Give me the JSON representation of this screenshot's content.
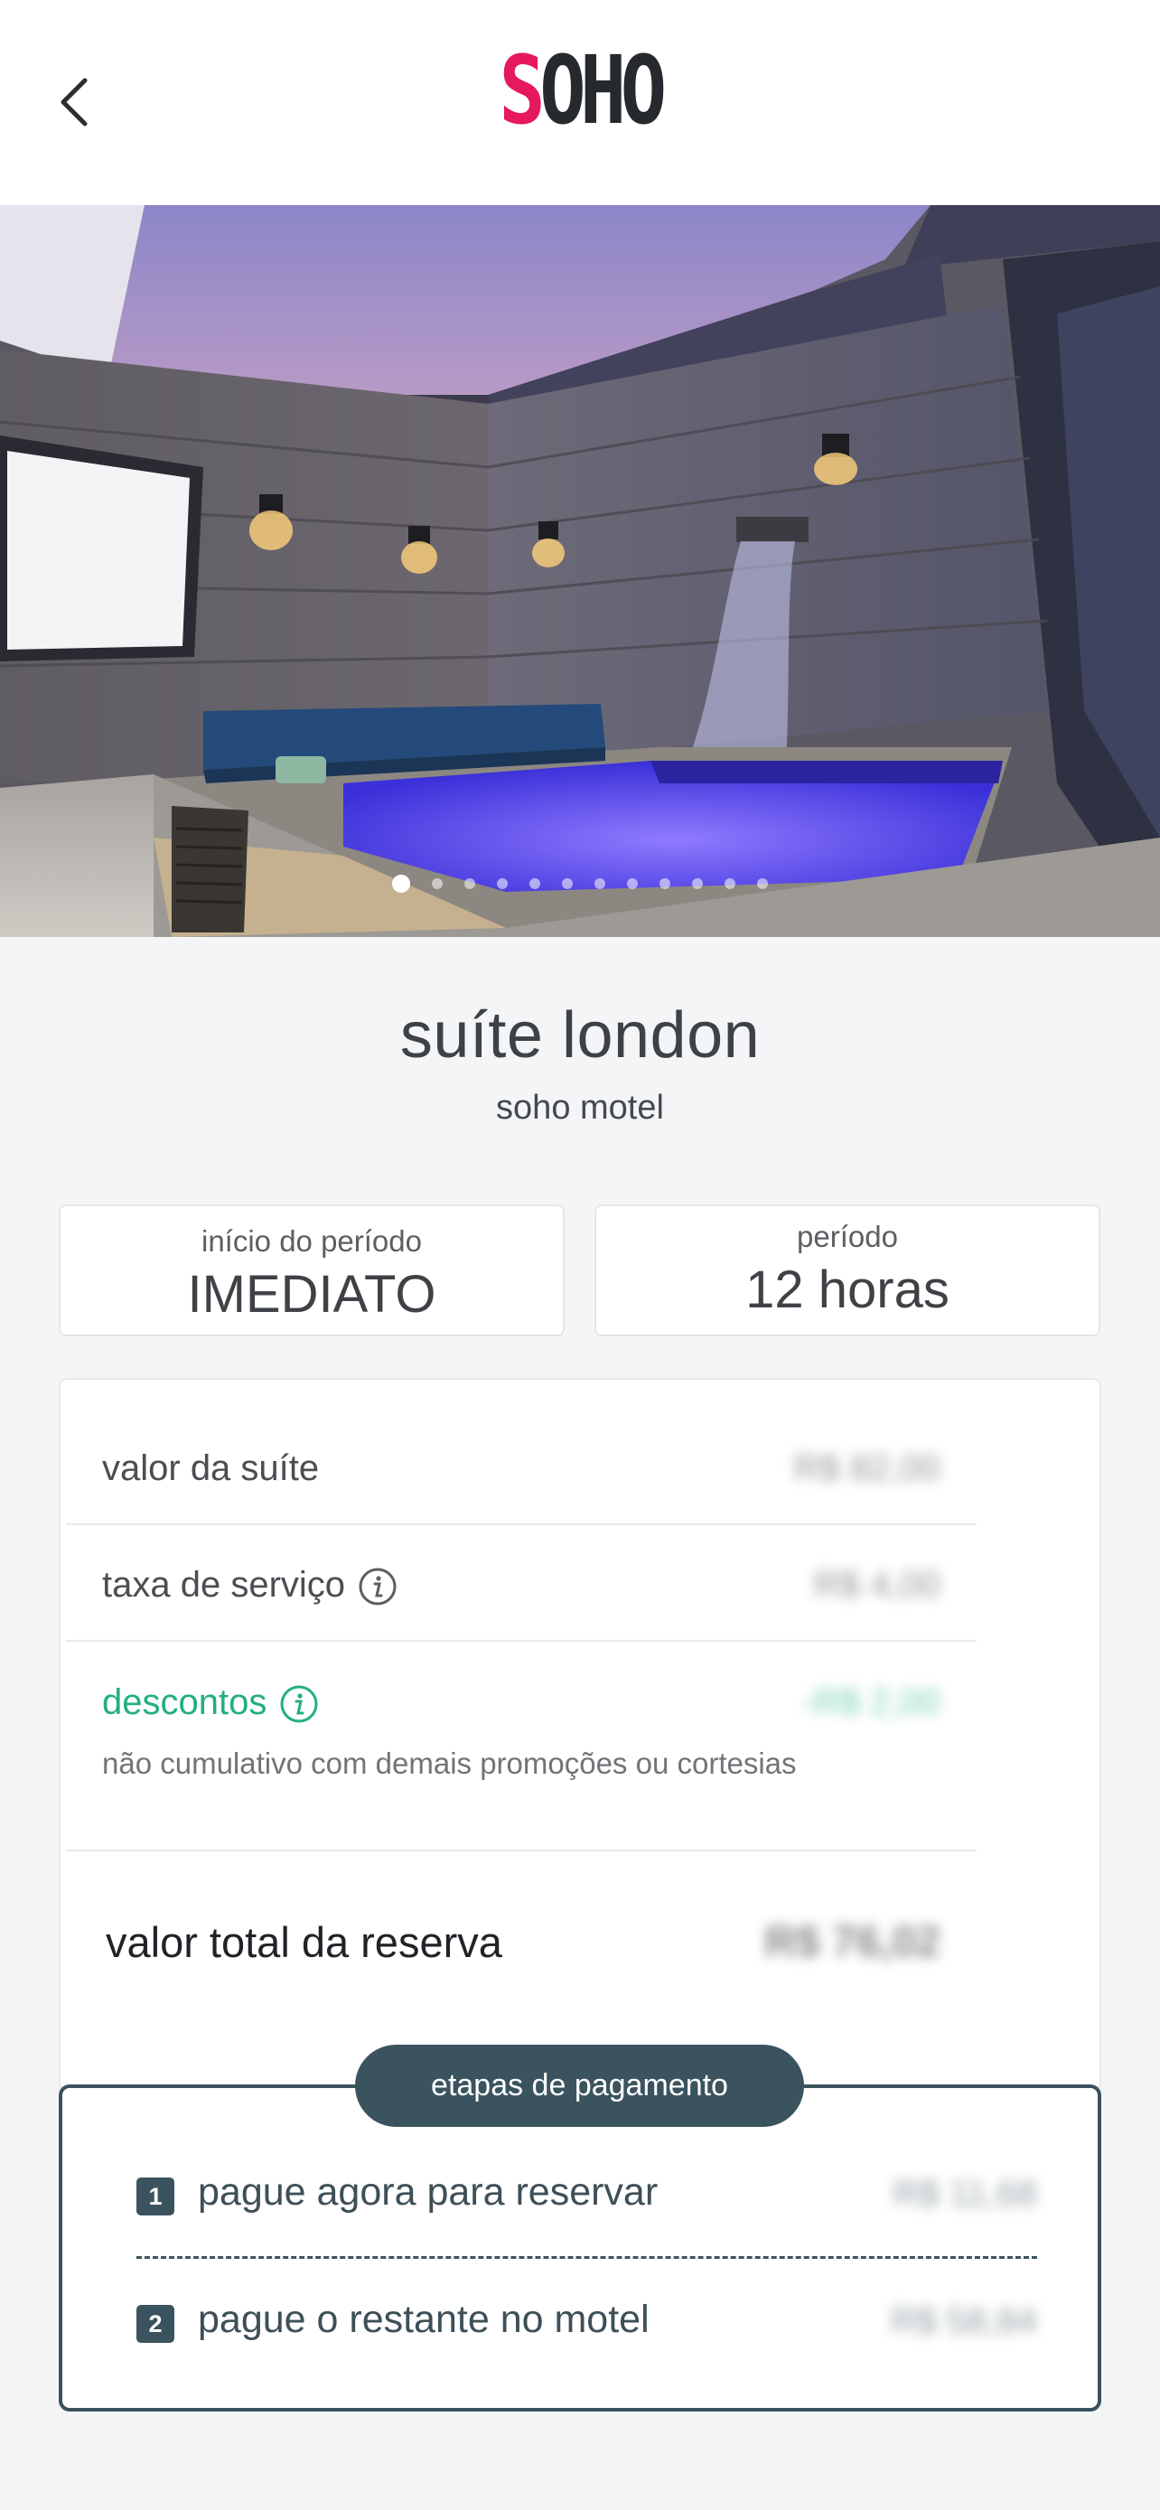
{
  "header": {
    "logo_first": "S",
    "logo_rest": "OHO",
    "brand_color": "#e5195b"
  },
  "gallery": {
    "photo_count": 12,
    "active_index": 0
  },
  "suite": {
    "title": "suíte london",
    "subtitle": "soho motel"
  },
  "period": {
    "start_label": "início do período",
    "start_value": "IMEDIATO",
    "duration_label": "período",
    "duration_value": "12 horas"
  },
  "summary": {
    "suite_value_label": "valor da suíte",
    "suite_value": "R$ 82,00",
    "service_fee_label": "taxa de serviço",
    "service_fee": "R$ 4,00",
    "discounts_label": "descontos",
    "discounts": "-R$ 2,00",
    "discounts_note": "não cumulativo com demais promoções ou cortesias",
    "total_label": "valor total da reserva",
    "total": "R$ 76,02"
  },
  "payment_steps": {
    "title": "etapas de pagamento",
    "step1_number": "1",
    "step1_label": "pague agora para reservar",
    "step1_amount": "R$ 11,68",
    "step2_number": "2",
    "step2_label": "pague o restante no motel",
    "step2_amount": "R$ 58,84",
    "accent_color": "#3a535e"
  }
}
